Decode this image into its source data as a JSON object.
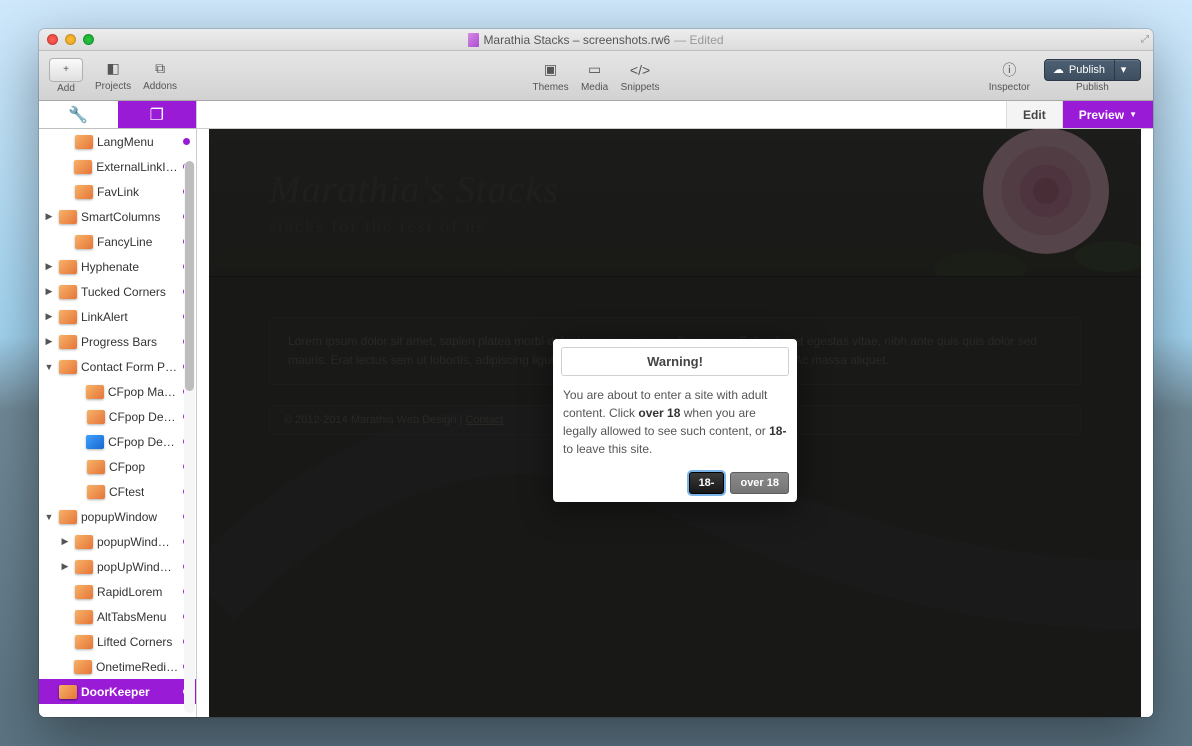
{
  "window": {
    "title": "Marathia Stacks – screenshots.rw6",
    "edited_suffix": "— Edited"
  },
  "toolbar": {
    "add": "Add",
    "projects": "Projects",
    "addons": "Addons",
    "themes": "Themes",
    "media": "Media",
    "snippets": "Snippets",
    "inspector": "Inspector",
    "publish_button": "Publish",
    "publish_label": "Publish"
  },
  "sidebar": {
    "items": [
      {
        "label": "LangMenu",
        "indent": 2,
        "disclosure": "none",
        "icon": "orange"
      },
      {
        "label": "ExternalLinkIcon",
        "indent": 2,
        "disclosure": "none",
        "icon": "orange"
      },
      {
        "label": "FavLink",
        "indent": 2,
        "disclosure": "none",
        "icon": "orange"
      },
      {
        "label": "SmartColumns",
        "indent": 1,
        "disclosure": "collapsed",
        "icon": "orange"
      },
      {
        "label": "FancyLine",
        "indent": 2,
        "disclosure": "none",
        "icon": "orange"
      },
      {
        "label": "Hyphenate",
        "indent": 1,
        "disclosure": "collapsed",
        "icon": "orange"
      },
      {
        "label": "Tucked Corners",
        "indent": 1,
        "disclosure": "collapsed",
        "icon": "orange"
      },
      {
        "label": "LinkAlert",
        "indent": 1,
        "disclosure": "collapsed",
        "icon": "orange"
      },
      {
        "label": "Progress Bars",
        "indent": 1,
        "disclosure": "collapsed",
        "icon": "orange"
      },
      {
        "label": "Contact Form P…",
        "indent": 1,
        "disclosure": "expanded",
        "icon": "orange"
      },
      {
        "label": "CFpop Manual",
        "indent": 3,
        "disclosure": "none",
        "icon": "orange"
      },
      {
        "label": "CFpop Demo",
        "indent": 3,
        "disclosure": "none",
        "icon": "orange"
      },
      {
        "label": "CFpop Dem…",
        "indent": 3,
        "disclosure": "none",
        "icon": "blue"
      },
      {
        "label": "CFpop",
        "indent": 3,
        "disclosure": "none",
        "icon": "orange"
      },
      {
        "label": "CFtest",
        "indent": 3,
        "disclosure": "none",
        "icon": "orange"
      },
      {
        "label": "popupWindow",
        "indent": 1,
        "disclosure": "expanded",
        "icon": "orange"
      },
      {
        "label": "popupWind…",
        "indent": 2,
        "disclosure": "collapsed",
        "icon": "orange"
      },
      {
        "label": "popUpWind…",
        "indent": 2,
        "disclosure": "collapsed",
        "icon": "orange"
      },
      {
        "label": "RapidLorem",
        "indent": 2,
        "disclosure": "none",
        "icon": "orange"
      },
      {
        "label": "AltTabsMenu",
        "indent": 2,
        "disclosure": "none",
        "icon": "orange"
      },
      {
        "label": "Lifted Corners",
        "indent": 2,
        "disclosure": "none",
        "icon": "orange"
      },
      {
        "label": "OnetimeRedirect",
        "indent": 2,
        "disclosure": "none",
        "icon": "orange"
      },
      {
        "label": "DoorKeeper",
        "indent": 1,
        "disclosure": "none",
        "icon": "orange",
        "selected": true
      }
    ]
  },
  "view_tabs": {
    "edit": "Edit",
    "preview": "Preview"
  },
  "page": {
    "heading": "Marathia's Stacks",
    "subheading": "stacks for the rest of us",
    "lorem": "Lorem ipsum dolor sit amet, sapien platea morbi dolor lacus nunc, nunc ullamcorper. Felis aliquet egestas vitae, nibh ante quis quis dolor sed mauris. Erat lectus sem ut lobortis, adipiscing ligula eleifend, sodales fringilla mattis dui nullam. Ac massa aliquet.",
    "footer_prefix": "© 2012-2014 Marathia Web Design | ",
    "footer_link": "Contact"
  },
  "modal": {
    "title": "Warning!",
    "line1_a": "You are about to enter a site with adult content. Click ",
    "bold1": "over 18",
    "line1_b": " when you are legally allowed to see such content, or ",
    "bold2": "18-",
    "line1_c": " to leave this site.",
    "btn_primary": "18-",
    "btn_secondary": "over 18"
  }
}
